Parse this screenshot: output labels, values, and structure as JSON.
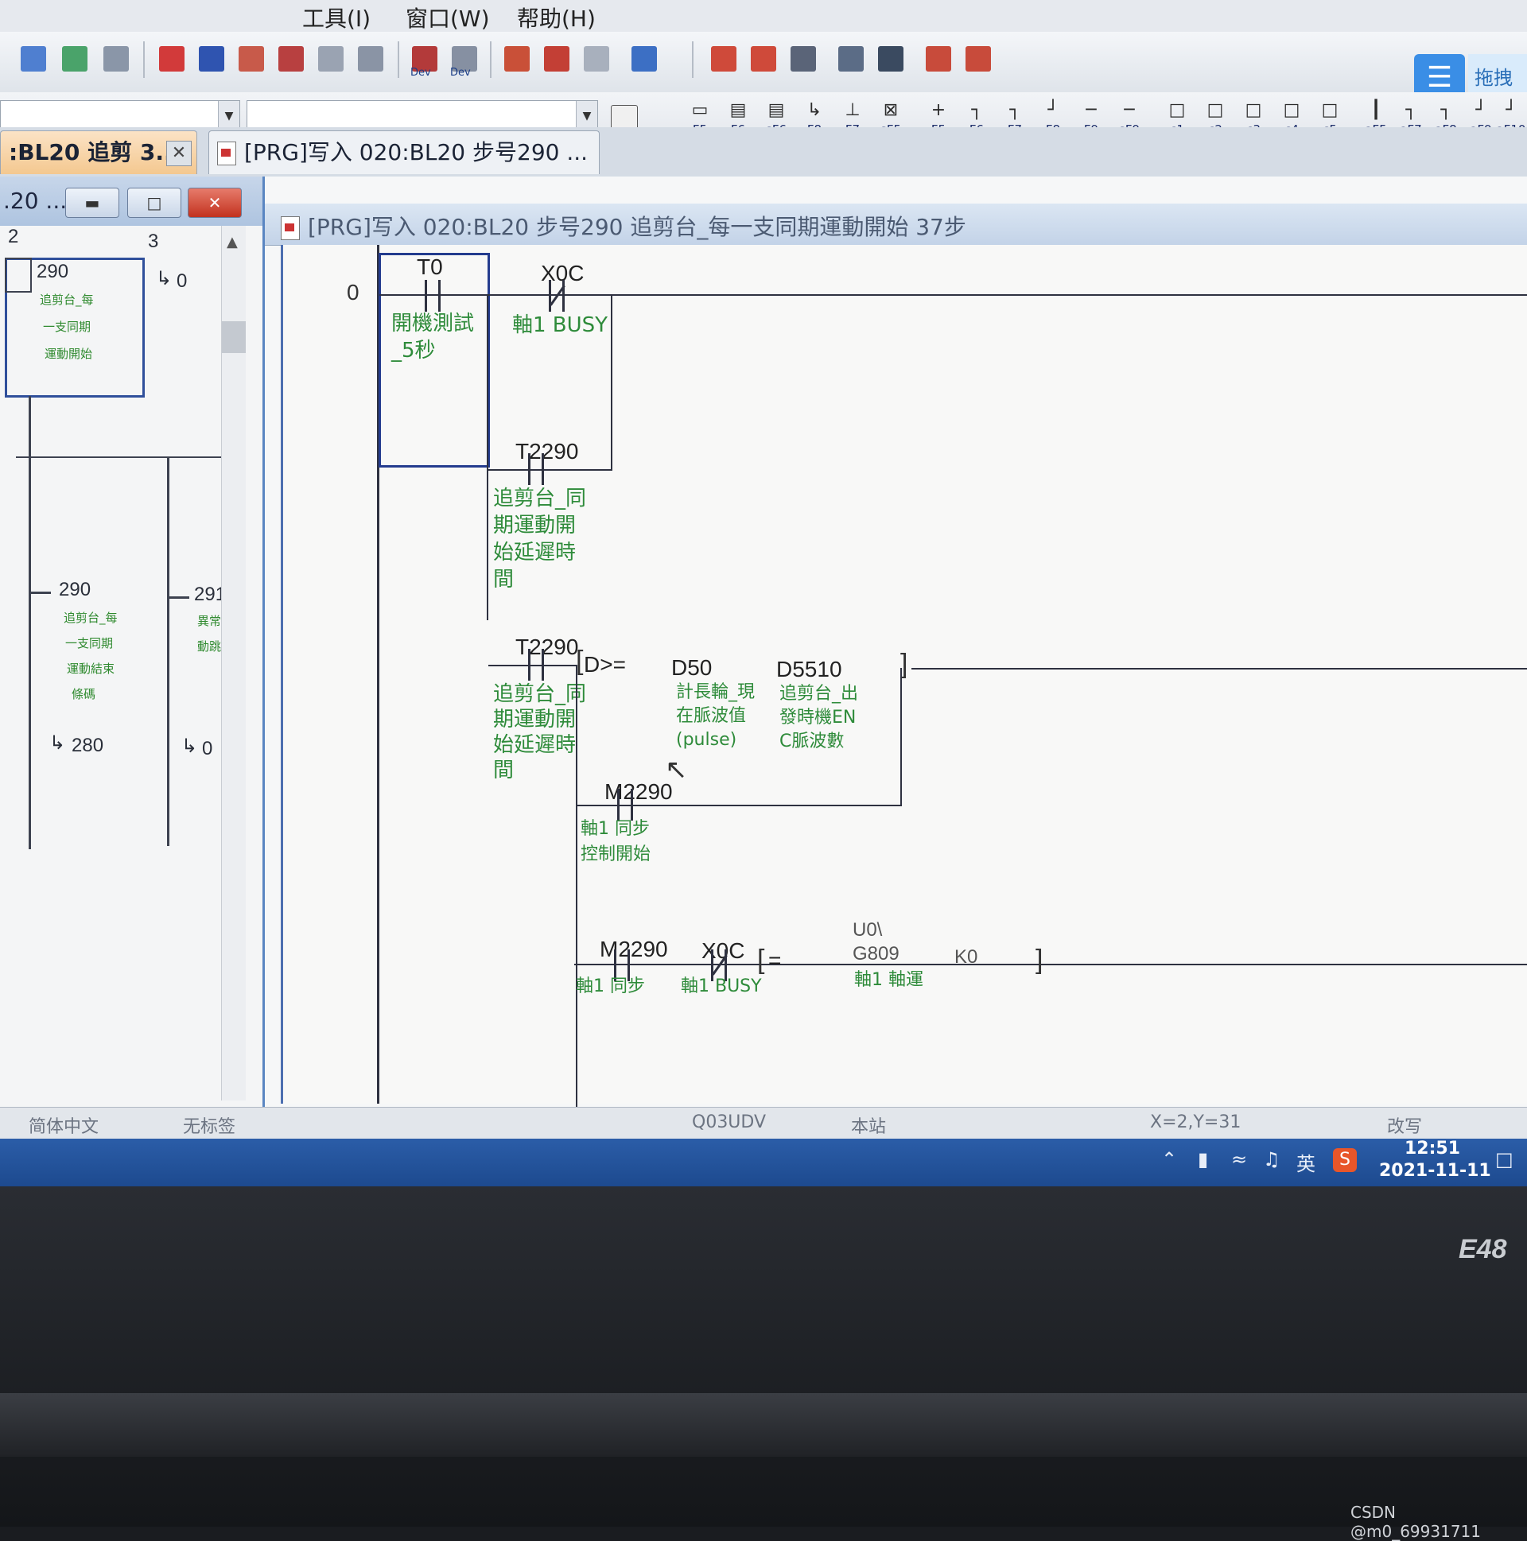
{
  "menu": {
    "tools": "工具(I)",
    "window": "窗口(W)",
    "help": "帮助(H)"
  },
  "toolbar": {
    "dev_caption": "Dev",
    "cloud_text": "拖拽",
    "fkeys": [
      "F5",
      "F6",
      "sF6",
      "F8",
      "F7",
      "sF5",
      "F5",
      "F6",
      "F7",
      "F8",
      "F9",
      "sF9",
      "c1",
      "c2",
      "c3",
      "c4",
      "c5",
      "aF5",
      "aF7",
      "aF8",
      "aF9",
      "aF10"
    ]
  },
  "tabs": [
    {
      "label": ":BL20 追剪 3...",
      "state": "active"
    },
    {
      "label": "[PRG]写入 020:BL20 步号290 ...",
      "state": "inactive"
    }
  ],
  "left_window": {
    "title": ".20 ...",
    "col_a": "2",
    "col_b": "3",
    "step_box": "290",
    "step_box_comment": [
      "追剪台_每",
      "一支同期",
      "運動開始"
    ],
    "jump_top": "0",
    "branch_left_step": "290",
    "branch_left_comment": [
      "追剪台_每",
      "一支同期",
      "運動結束",
      "條碼"
    ],
    "branch_right_step": "291",
    "branch_right_comment": [
      "異常暫",
      "動跳轉"
    ],
    "jump_left": "280",
    "jump_right": "0"
  },
  "ladder": {
    "title": "[PRG]写入 020:BL20 步号290 追剪台_每一支同期運動開始 37步",
    "step_number": "0",
    "contacts": [
      {
        "device": "T0",
        "comment": [
          "開機測試",
          "_5秒"
        ]
      },
      {
        "device": "X0C",
        "comment": [
          "軸1 BUSY"
        ]
      },
      {
        "device": "T2290",
        "comment": [
          "追剪台_同",
          "期運動開",
          "始延遲時",
          "間"
        ]
      },
      {
        "device": "T2290",
        "comment": [
          "追剪台_同",
          "期運動開",
          "始延遲時",
          "間"
        ]
      },
      {
        "device": "M2290",
        "comment": [
          "軸1 同步",
          "控制開始"
        ]
      },
      {
        "device": "M2290",
        "comment": [
          "軸1 同步"
        ]
      },
      {
        "device": "X0C",
        "comment": [
          "軸1 BUSY"
        ]
      }
    ],
    "compare": {
      "op": "D>=",
      "arg1": "D50",
      "arg1_comment": [
        "計長輪_現",
        "在脈波值",
        "(pulse)"
      ],
      "arg2": "D5510",
      "arg2_comment": [
        "追剪台_出",
        "發時機EN",
        "C脈波數"
      ]
    },
    "compare2": {
      "op": "=",
      "arg1_top": "U0\\",
      "arg1": "G809",
      "arg1_comment": "軸1 軸運",
      "arg2": "K0"
    }
  },
  "statusbar": {
    "language": "简体中文",
    "title": "无标签",
    "cpu": "Q03UDV",
    "station": "本站",
    "coords": "X=2,Y=31",
    "mode": "改写"
  },
  "taskbar": {
    "ime": "英",
    "time": "12:51",
    "date": "2021-11-11"
  },
  "bezel": {
    "model": "E48"
  },
  "watermark": "CSDN @m0_69931711"
}
